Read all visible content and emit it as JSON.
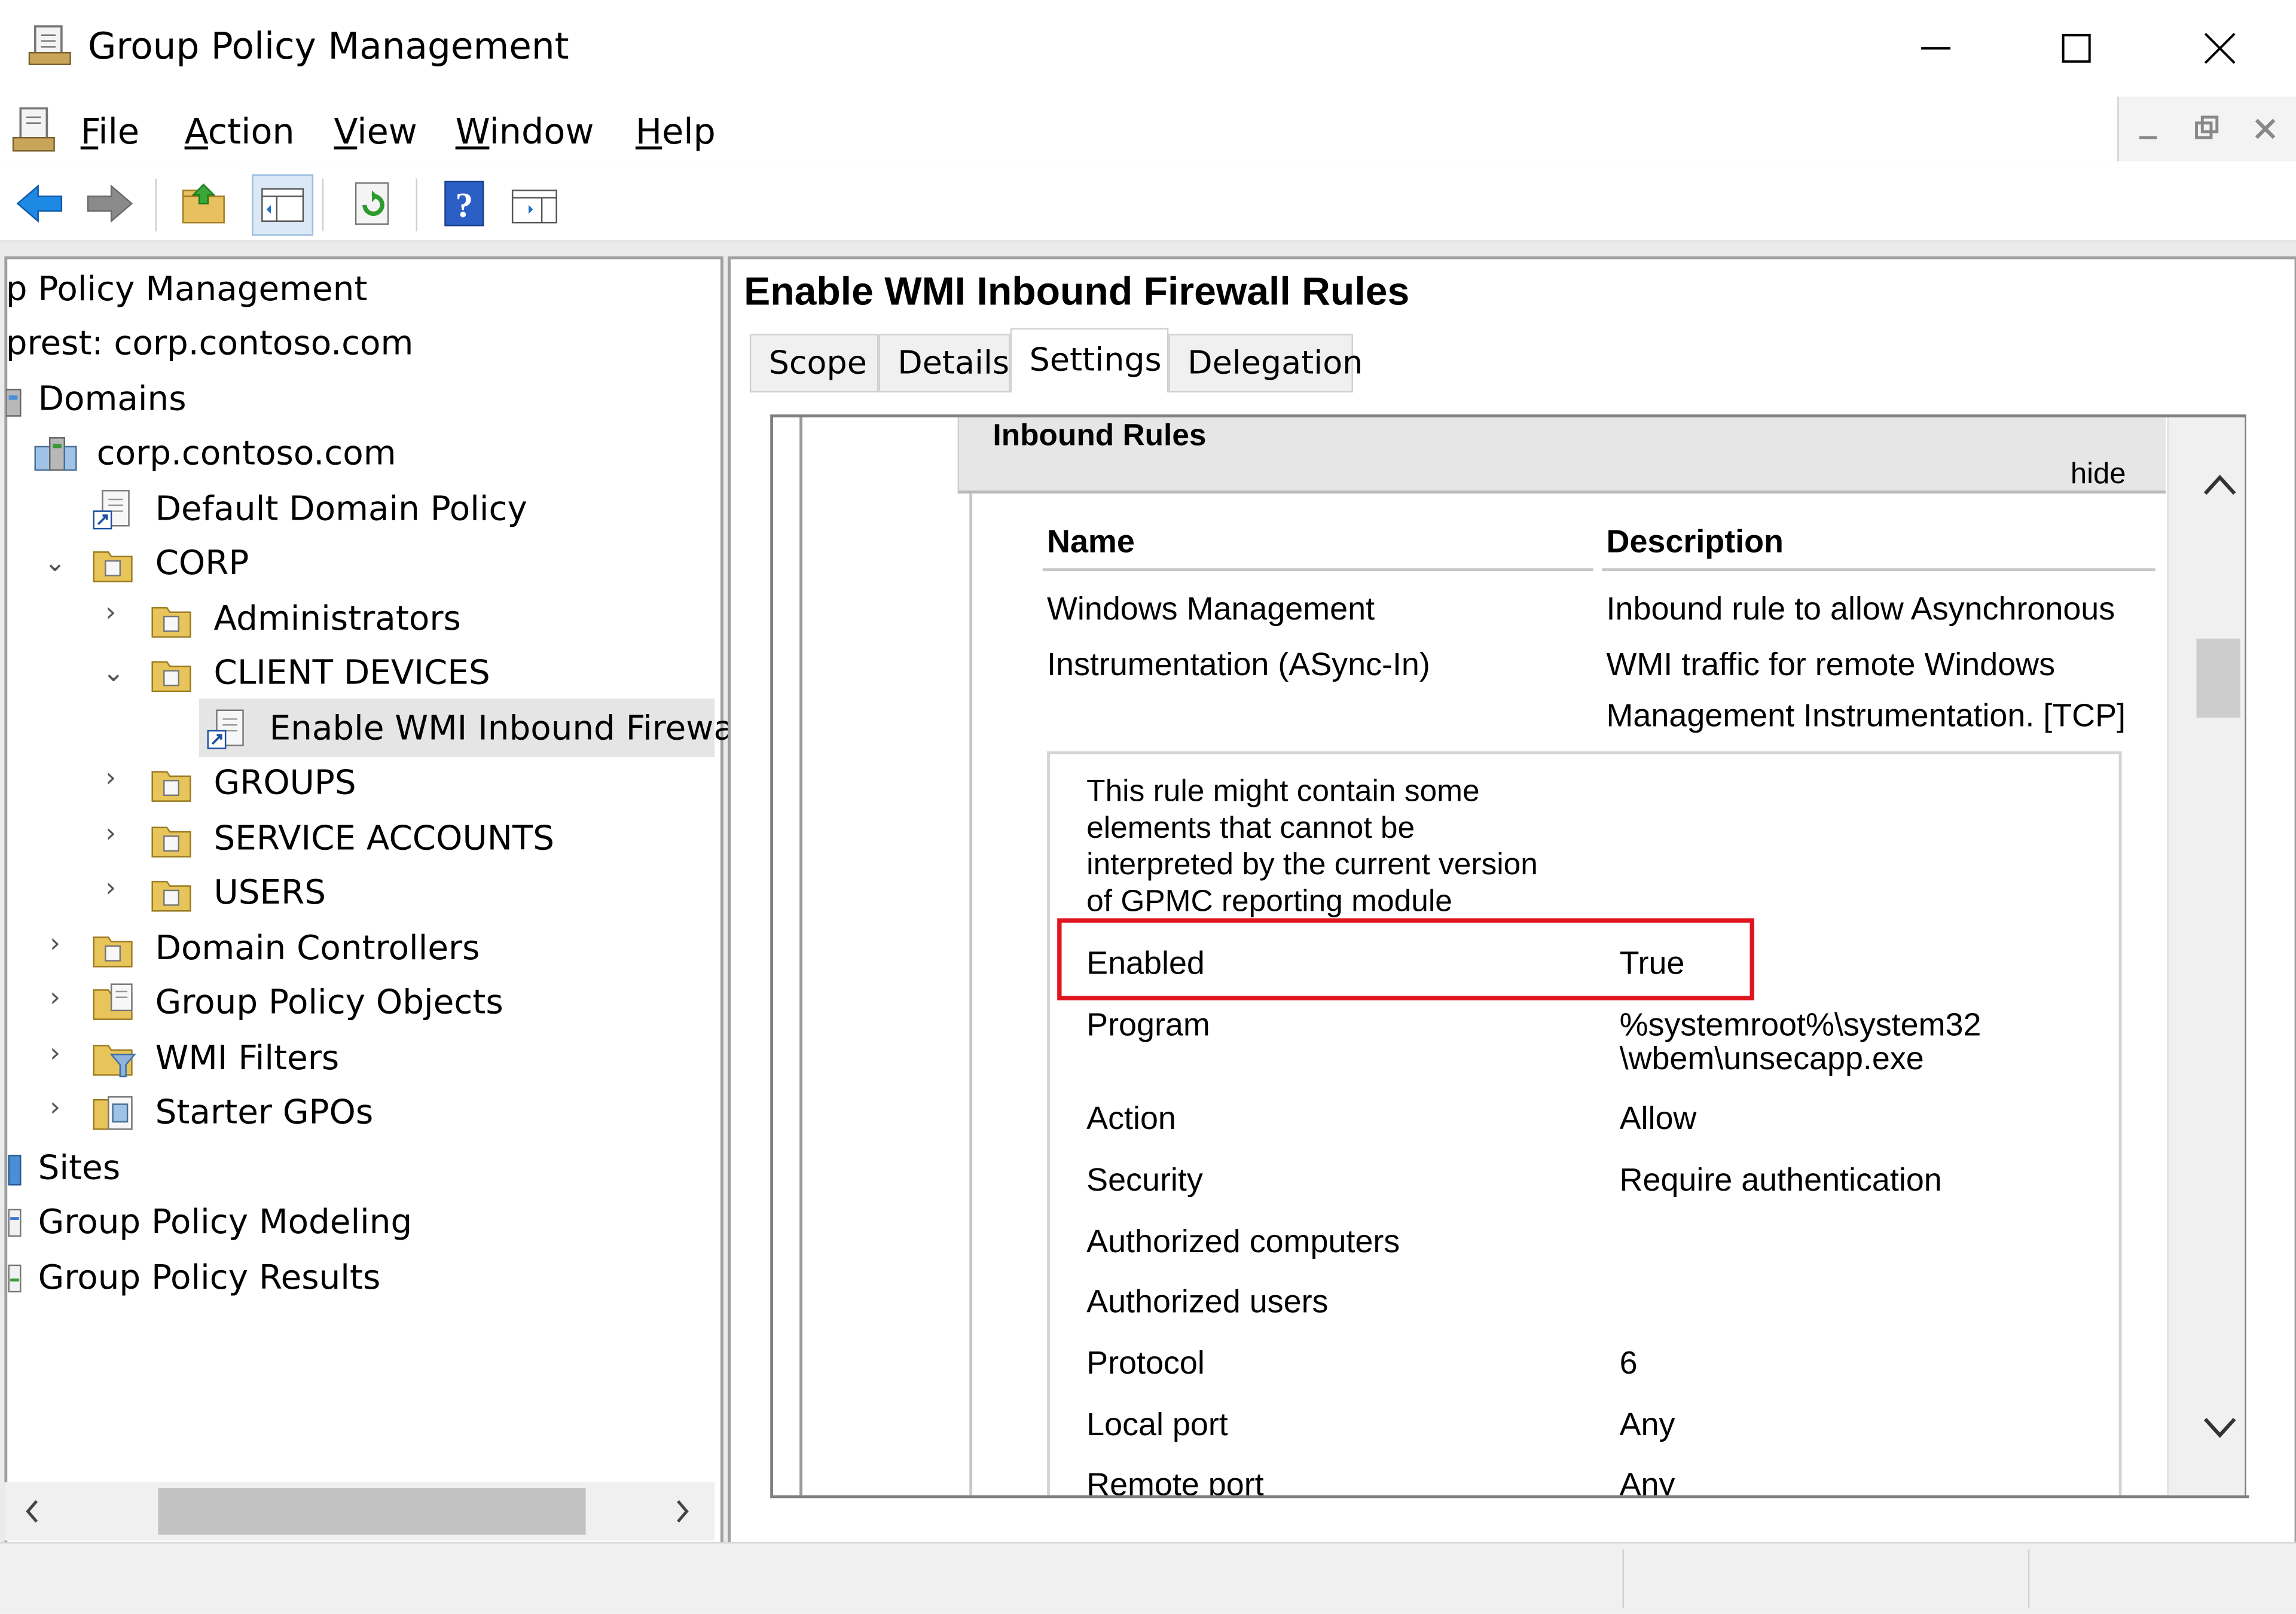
{
  "window": {
    "title": "Group Policy Management"
  },
  "menu": {
    "items": [
      {
        "label": "File",
        "u": "F",
        "rest": "ile"
      },
      {
        "label": "Action",
        "u": "A",
        "rest": "ction"
      },
      {
        "label": "View",
        "u": "V",
        "rest": "iew"
      },
      {
        "label": "Window",
        "u": "W",
        "rest": "indow"
      },
      {
        "label": "Help",
        "u": "H",
        "rest": "elp"
      }
    ]
  },
  "tree": {
    "items": [
      {
        "label": "p Policy Management",
        "icon": "gpm-root-icon"
      },
      {
        "label": "prest: corp.contoso.com",
        "icon": "forest-icon"
      },
      {
        "label": "Domains",
        "icon": "domains-icon"
      },
      {
        "label": "corp.contoso.com",
        "icon": "domain-icon"
      },
      {
        "label": "Default Domain Policy",
        "icon": "gpo-link-icon"
      },
      {
        "label": "CORP",
        "icon": "ou-folder-icon"
      },
      {
        "label": "Administrators",
        "icon": "ou-folder-icon"
      },
      {
        "label": "CLIENT DEVICES",
        "icon": "ou-folder-icon"
      },
      {
        "label": "Enable WMI Inbound Firewa",
        "icon": "gpo-link-icon"
      },
      {
        "label": "GROUPS",
        "icon": "ou-folder-icon"
      },
      {
        "label": "SERVICE ACCOUNTS",
        "icon": "ou-folder-icon"
      },
      {
        "label": "USERS",
        "icon": "ou-folder-icon"
      },
      {
        "label": "Domain Controllers",
        "icon": "ou-folder-icon"
      },
      {
        "label": "Group Policy Objects",
        "icon": "gpo-container-icon"
      },
      {
        "label": "WMI Filters",
        "icon": "wmi-filter-icon"
      },
      {
        "label": "Starter GPOs",
        "icon": "starter-gpo-icon"
      },
      {
        "label": "Sites",
        "icon": "sites-icon"
      },
      {
        "label": "Group Policy Modeling",
        "icon": "modeling-icon"
      },
      {
        "label": "Group Policy Results",
        "icon": "results-icon"
      }
    ]
  },
  "right": {
    "title": "Enable WMI Inbound Firewall Rules",
    "tabs": [
      "Scope",
      "Details",
      "Settings",
      "Delegation"
    ],
    "active_tab": "Settings"
  },
  "report": {
    "section_title": "Inbound Rules",
    "hide_label": "hide",
    "col_name": "Name",
    "col_description": "Description",
    "rule_name_1": "Windows Management",
    "rule_name_2": "Instrumentation (ASync-In)",
    "rule_desc_1": "Inbound rule to allow Asynchronous",
    "rule_desc_2": "WMI traffic for remote Windows",
    "rule_desc_3": "Management Instrumentation. [TCP]",
    "warning_1": "This rule might contain some",
    "warning_2": "elements that cannot be",
    "warning_3": "interpreted by the current version",
    "warning_4": "of GPMC reporting module",
    "props": {
      "enabled_label": "Enabled",
      "enabled_value": "True",
      "program_label": "Program",
      "program_value_1": "%systemroot%\\system32",
      "program_value_2": "\\wbem\\unsecapp.exe",
      "action_label": "Action",
      "action_value": "Allow",
      "security_label": "Security",
      "security_value": "Require authentication",
      "auth_computers_label": "Authorized computers",
      "auth_users_label": "Authorized users",
      "protocol_label": "Protocol",
      "protocol_value": "6",
      "local_port_label": "Local port",
      "local_port_value": "Any",
      "remote_port_label": "Remote port",
      "remote_port_value": "Any"
    }
  },
  "colors": {
    "highlight_box": "#e0141e",
    "selected_row": "#e5e5e5",
    "section_header": "#e6e6e6"
  }
}
